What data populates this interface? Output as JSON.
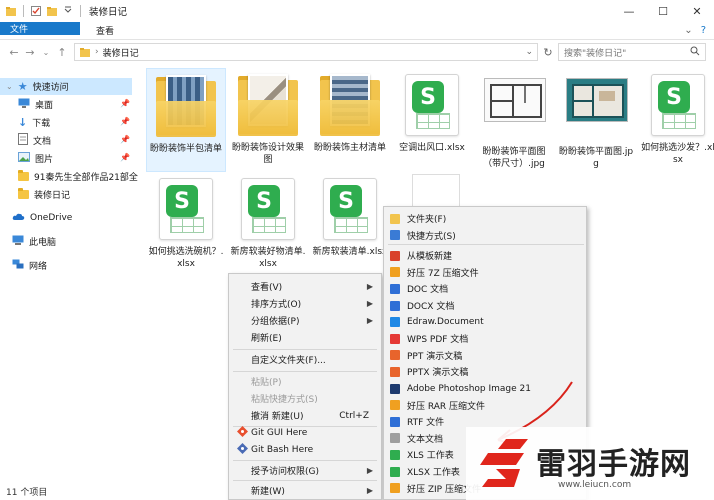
{
  "window": {
    "title": "装修日记",
    "controls": [
      "—",
      "☐",
      "✕"
    ]
  },
  "ribbon": {
    "tabs": [
      "文件",
      "主页",
      "共享",
      "查看"
    ]
  },
  "address": {
    "path": "装修日记",
    "search_placeholder": "搜索\"装修日记\""
  },
  "nav": {
    "quick_access": "快速访问",
    "items": [
      {
        "label": "桌面",
        "pinned": true
      },
      {
        "label": "下载",
        "pinned": true
      },
      {
        "label": "文档",
        "pinned": true
      },
      {
        "label": "图片",
        "pinned": true
      },
      {
        "label": "91秦先生全部作品21部全",
        "pinned": false
      },
      {
        "label": "装修日记",
        "pinned": false
      }
    ],
    "onedrive": "OneDrive",
    "this_pc": "此电脑",
    "network": "网络"
  },
  "files": [
    {
      "name": "盼盼装饰半包清单",
      "type": "folder"
    },
    {
      "name": "盼盼装饰设计效果图",
      "type": "folder"
    },
    {
      "name": "盼盼装饰主材清单",
      "type": "folder"
    },
    {
      "name": "空调出风口.xlsx",
      "type": "xlsx"
    },
    {
      "name": "盼盼装饰平面图（带尺寸）.jpg",
      "type": "jpg"
    },
    {
      "name": "盼盼装饰平面图.jpg",
      "type": "jpg"
    },
    {
      "name": "如何挑选沙发？.xlsx",
      "type": "xlsx"
    },
    {
      "name": "如何挑选洗碗机？.xlsx",
      "type": "xlsx"
    },
    {
      "name": "新房软装好物清单.xlsx",
      "type": "xlsx"
    },
    {
      "name": "新房软装清单.xlsx",
      "type": "xlsx"
    }
  ],
  "context_menu": {
    "items": [
      {
        "label": "查看(V)",
        "submenu": true
      },
      {
        "label": "排序方式(O)",
        "submenu": true
      },
      {
        "label": "分组依据(P)",
        "submenu": true
      },
      {
        "label": "刷新(E)"
      },
      {
        "label": "自定义文件夹(F)..."
      },
      {
        "label": "粘贴(P)",
        "disabled": true
      },
      {
        "label": "粘贴快捷方式(S)",
        "disabled": true
      },
      {
        "label": "撤消 新建(U)",
        "shortcut": "Ctrl+Z"
      },
      {
        "label": "Git GUI Here"
      },
      {
        "label": "Git Bash Here"
      },
      {
        "label": "授予访问权限(G)",
        "submenu": true
      },
      {
        "label": "新建(W)",
        "submenu": true
      }
    ]
  },
  "new_submenu": {
    "items": [
      {
        "label": "文件夹(F)",
        "color": "#f2c44d"
      },
      {
        "label": "快捷方式(S)",
        "color": "#3a7bd5"
      },
      {
        "label": "从模板新建",
        "color": "#d9412b"
      },
      {
        "label": "好压 7Z 压缩文件",
        "color": "#f0a020"
      },
      {
        "label": "DOC 文档",
        "color": "#2f6fd6"
      },
      {
        "label": "DOCX 文档",
        "color": "#2f6fd6"
      },
      {
        "label": "Edraw.Document",
        "color": "#1e88e5"
      },
      {
        "label": "WPS PDF 文档",
        "color": "#e53935"
      },
      {
        "label": "PPT 演示文稿",
        "color": "#e8642c"
      },
      {
        "label": "PPTX 演示文稿",
        "color": "#e8642c"
      },
      {
        "label": "Adobe Photoshop Image 21",
        "color": "#1d3a6e"
      },
      {
        "label": "好压 RAR 压缩文件",
        "color": "#f0a020"
      },
      {
        "label": "RTF 文件",
        "color": "#2f6fd6"
      },
      {
        "label": "文本文档",
        "color": "#9e9e9e"
      },
      {
        "label": "XLS 工作表",
        "color": "#2fad4f"
      },
      {
        "label": "XLSX 工作表",
        "color": "#2fad4f"
      },
      {
        "label": "好压 ZIP 压缩文件",
        "color": "#f0a020"
      }
    ]
  },
  "status": {
    "count": "11 个项目"
  },
  "watermark": {
    "title": "雷羽手游网",
    "url": "www.leiucn.com",
    "color": "#e0261c"
  }
}
